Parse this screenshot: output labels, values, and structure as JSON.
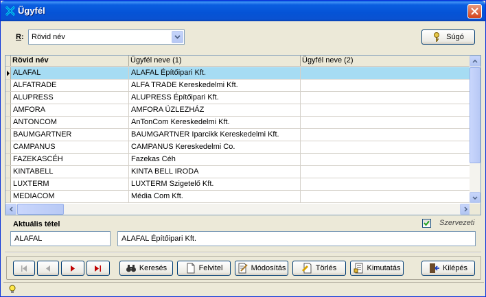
{
  "window": {
    "title": "Ügyfél"
  },
  "filter": {
    "label_prefix": "R",
    "label_suffix": ":",
    "selected": "Rövid név"
  },
  "help_button": {
    "label": "Súgó"
  },
  "grid": {
    "columns": [
      "Rövid név",
      "Ügyfél neve (1)",
      "Ügyfél neve (2)"
    ],
    "rows": [
      [
        "ALAFAL",
        "ALAFAL Építőipari Kft.",
        ""
      ],
      [
        "ALFATRADE",
        "ALFA TRADE Kereskedelmi Kft.",
        ""
      ],
      [
        "ALUPRESS",
        "ALUPRESS Építőipari Kft.",
        ""
      ],
      [
        "AMFORA",
        "AMFORA ÜZLEZHÁZ",
        ""
      ],
      [
        "ANTONCOM",
        "AnTonCom Kereskedelmi Kft.",
        ""
      ],
      [
        "BAUMGARTNER",
        "BAUMGARTNER Iparcikk Kereskedelmi Kft.",
        ""
      ],
      [
        "CAMPANUS",
        "CAMPANUS Kereskedelmi  Co.",
        ""
      ],
      [
        "FAZEKASCÉH",
        "Fazekas Céh",
        ""
      ],
      [
        "KINTABELL",
        "KINTA BELL IRODA",
        ""
      ],
      [
        "LUXTERM",
        "LUXTERM Szigetelő Kft.",
        ""
      ],
      [
        "MEDIACOM",
        "Média Com Kft.",
        ""
      ]
    ],
    "selected_row": 0
  },
  "current": {
    "label": "Aktuális tétel",
    "short_name": "ALAFAL",
    "full_name": "ALAFAL Építőipari Kft.",
    "checkbox_label": "Szervezeti",
    "checkbox_checked": true
  },
  "toolbar": {
    "search": "Keresés",
    "add": "Felvitel",
    "edit": "Módosítás",
    "delete": "Törlés",
    "report": "Kimutatás",
    "exit": "Kilépés"
  },
  "colors": {
    "accent_red": "#c00000",
    "selection": "#316ac5",
    "row_highlight": "#a6dcf3"
  }
}
